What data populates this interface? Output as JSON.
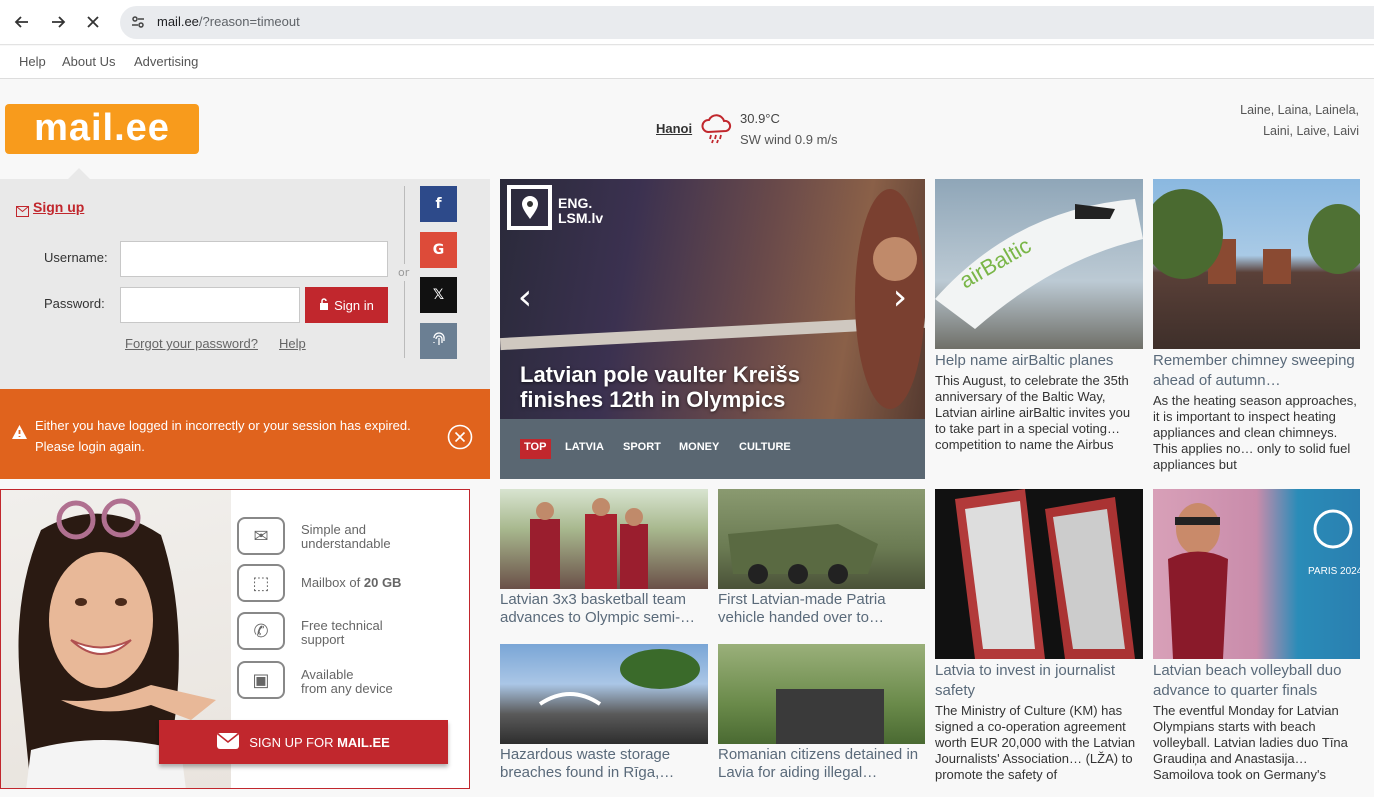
{
  "browser": {
    "url_host": "mail.ee",
    "url_path": "/?reason=timeout"
  },
  "toplinks": [
    "Help",
    "About Us",
    "Advertising"
  ],
  "logo": "mail.ee",
  "weather": {
    "city": "Hanoi",
    "temp": "30.9°C",
    "wind": "SW wind 0.9 m/s",
    "icon": "rain-cloud-icon"
  },
  "namedays": {
    "line1": "Laine, Laina, Lainela,",
    "line2": "Laini, Laive, Laivi"
  },
  "login": {
    "signup": "Sign up",
    "username_label": "Username:",
    "password_label": "Password:",
    "signin": "Sign in",
    "forgot": "Forgot your password?",
    "help": "Help",
    "or": "or"
  },
  "social": {
    "facebook": "f",
    "google": "G",
    "x": "𝕏"
  },
  "error": {
    "message": "Either you have logged in incorrectly or your session has expired. Please login again."
  },
  "promo": {
    "features": [
      {
        "line1": "Simple and",
        "line2": "understandable"
      },
      {
        "line1": "Mailbox of ",
        "bold": "20 GB"
      },
      {
        "line1": "Free technical",
        "line2": "support"
      },
      {
        "line1": "Available",
        "line2": "from any device"
      }
    ],
    "button_prefix": "SIGN UP FOR ",
    "button_bold": "MAIL.EE"
  },
  "hero": {
    "source": "ENG.\nLSM.lv",
    "source1": "ENG.",
    "source2": "LSM.lv",
    "title": "Latvian pole vaulter Kreišs finishes 12th in Olympics",
    "tabs": [
      "TOP",
      "LATVIA",
      "SPORT",
      "MONEY",
      "CULTURE"
    ]
  },
  "news_right": [
    {
      "title": "Help name airBaltic planes",
      "text": "This August, to celebrate the 35th anniversary of the Baltic Way, Latvian airline airBaltic invites you to take part in a special voting… competition to name the Airbus"
    },
    {
      "title": "Remember chimney sweeping ahead of autumn…",
      "text": "As the heating season approaches, it is important to inspect heating appliances and clean chimneys. This applies no… only to solid fuel appliances but"
    },
    {
      "title": "Latvia to invest in journalist safety",
      "text": "The Ministry of Culture (KM) has signed a co-operation agreement worth EUR 20,000 with the Latvian Journalists' Association… (LŽA) to promote the safety of"
    },
    {
      "title": "Latvian beach volleyball duo advance to quarter finals",
      "text": "The eventful Monday for Latvian Olympians starts with beach volleyball. Latvian ladies duo Tīna Graudiņa and Anastasija… Samoilova took on Germany's"
    }
  ],
  "news_small": [
    {
      "title": "Latvian 3x3 basketball team advances to Olympic semi-…"
    },
    {
      "title": "First Latvian-made Patria vehicle handed over to…"
    },
    {
      "title": "Hazardous waste storage breaches found in Rīga,…"
    },
    {
      "title": "Romanian citizens detained in Lavia for aiding illegal…"
    }
  ]
}
